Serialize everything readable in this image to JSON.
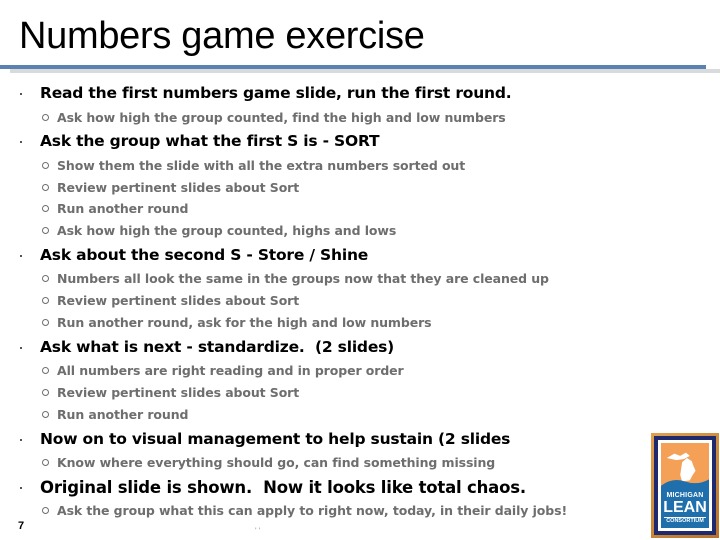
{
  "slide": {
    "title": "Numbers game exercise",
    "page_number": "7",
    "accent_color": "#5a82b0",
    "items": [
      {
        "text": "Read the first numbers game slide, run the first round.",
        "sub": [
          "Ask how high the group counted, find the high and low numbers"
        ]
      },
      {
        "text": "Ask the group what the first S is - SORT",
        "sub": [
          "Show them the slide with all the extra numbers sorted out",
          "Review pertinent slides about Sort",
          "Run another round",
          "Ask how high the group counted, highs and lows"
        ]
      },
      {
        "text": "Ask about the second S - Store / Shine",
        "sub": [
          "Numbers all look the same in the groups now that they are cleaned up",
          "Review pertinent slides about Sort",
          "Run another round, ask for the high and low numbers"
        ]
      },
      {
        "text": "Ask what is next - standardize.  (2 slides)",
        "sub": [
          "All numbers are right reading and in proper order",
          "Review pertinent slides about Sort",
          "Run another round"
        ]
      },
      {
        "text": "Now on to visual management to help sustain (2 slides",
        "sub": [
          "Know where everything should go, can find something missing"
        ]
      },
      {
        "text": "Original slide is shown.  Now it looks like total chaos.",
        "sub": [
          "Ask the group what this can apply to right now, today, in their daily jobs!"
        ]
      }
    ]
  },
  "logo": {
    "line1": "MICHIGAN",
    "line2": "LEAN",
    "line3": "CONSORTIUM"
  },
  "footer_mark": "' '"
}
